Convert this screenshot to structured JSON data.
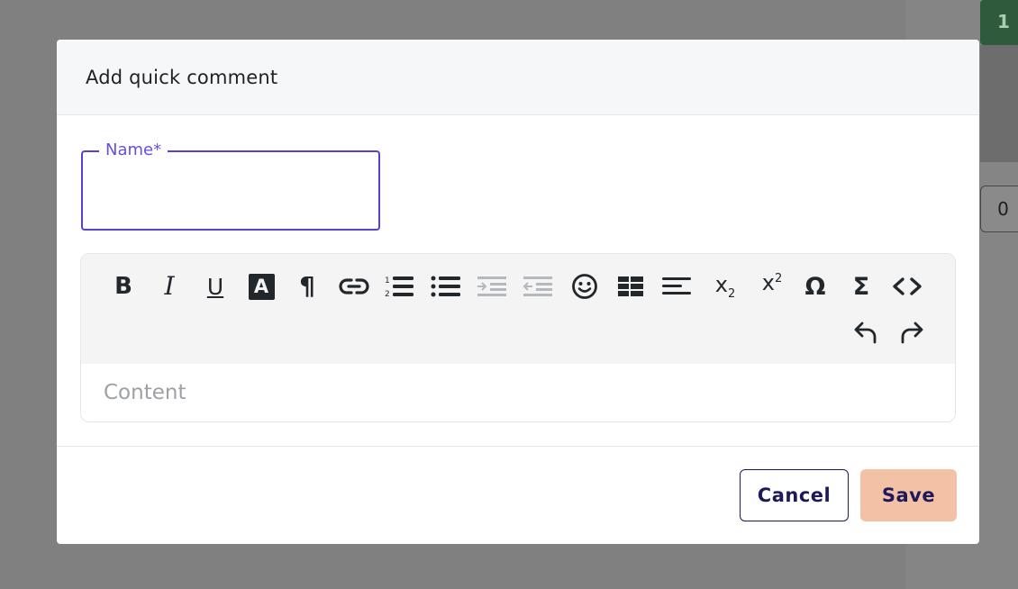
{
  "background": {
    "badge_value": "1",
    "count_value": "0"
  },
  "dialog": {
    "title": "Add quick comment",
    "name_field": {
      "label": "Name*",
      "value": ""
    },
    "editor": {
      "toolbar_icons": [
        "bold-icon",
        "italic-icon",
        "underline-icon",
        "text-color-icon",
        "paragraph-icon",
        "link-icon",
        "numbered-list-icon",
        "bulleted-list-icon",
        "indent-icon",
        "outdent-icon",
        "emoji-icon",
        "table-icon",
        "align-left-icon",
        "subscript-icon",
        "superscript-icon",
        "special-character-icon",
        "formula-icon",
        "code-icon",
        "undo-icon",
        "redo-icon"
      ],
      "glyphs": {
        "bold": "B",
        "italic": "I",
        "underline": "U",
        "text_color": "A",
        "paragraph": "¶",
        "subscript_base": "x",
        "subscript_mark": "2",
        "superscript_base": "x",
        "superscript_mark": "2",
        "omega": "Ω",
        "sigma": "Σ",
        "code": "<>"
      },
      "content_placeholder": "Content"
    },
    "footer": {
      "cancel_label": "Cancel",
      "save_label": "Save"
    }
  },
  "colors": {
    "overlay": "#808080",
    "accent_purple": "#5b3fd0",
    "navy_text": "#1e1a5a",
    "save_button_bg": "#f3c2a6",
    "toolbar_bg": "#f4f4f5"
  }
}
